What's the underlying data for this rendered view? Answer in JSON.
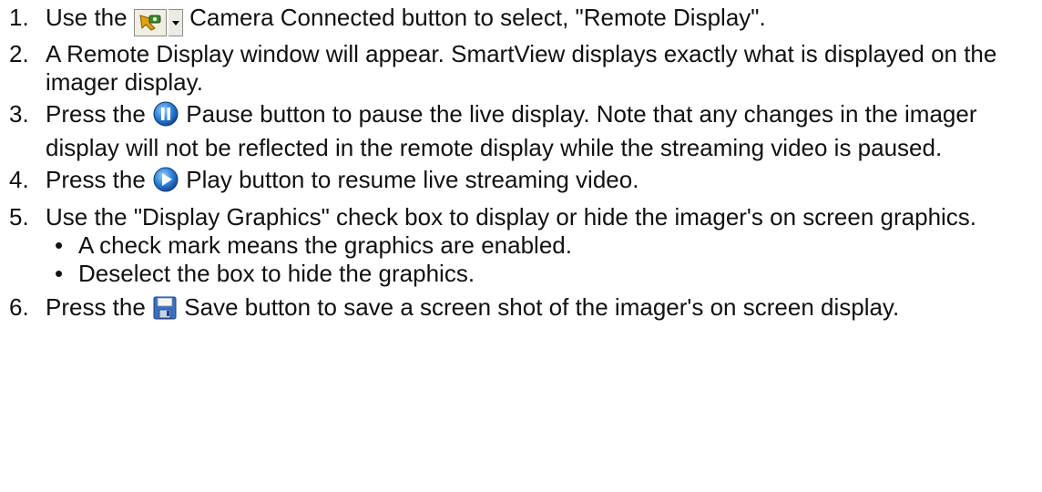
{
  "steps": [
    {
      "num": "1.",
      "before": "Use the",
      "icon": "camera-connected-icon",
      "after": "Camera Connected button to select, \"Remote Display\"."
    },
    {
      "num": "2.",
      "text": "A Remote Display window will appear. SmartView displays exactly what is displayed on the imager display."
    },
    {
      "num": "3.",
      "before": "Press the",
      "icon": "pause-icon",
      "after": "Pause button to pause the live display. Note that any changes in the imager display will not be reflected in the remote display while the streaming video is paused."
    },
    {
      "num": "4.",
      "before": "Press the",
      "icon": "play-icon",
      "after": "Play button to resume live streaming video."
    },
    {
      "num": "5.",
      "text": "Use the \"Display Graphics\" check box to display or hide the imager's on screen graphics.",
      "bullets": [
        "A check mark means the graphics are enabled.",
        "Deselect the box to hide the graphics."
      ]
    },
    {
      "num": "6.",
      "before": "Press the",
      "icon": "save-icon",
      "after": "Save button to save a screen shot of the imager's on screen display."
    }
  ],
  "bullet_glyph": "•"
}
